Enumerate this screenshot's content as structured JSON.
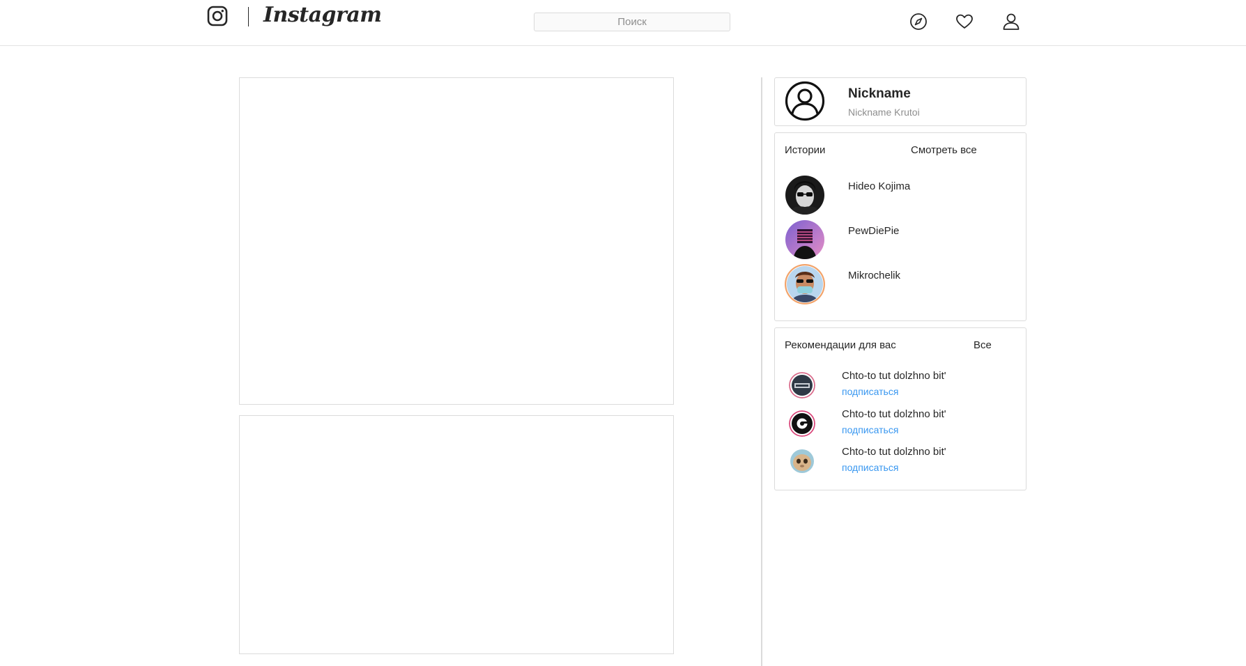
{
  "header": {
    "brand": "Instagram",
    "search_placeholder": "Поиск",
    "icons": [
      "instagram-logo-icon",
      "compass-icon",
      "heart-icon",
      "user-icon"
    ]
  },
  "profile": {
    "nickname": "Nickname",
    "full_name": "Nickname Krutoi"
  },
  "stories": {
    "title": "Истории",
    "see_all": "Смотреть все",
    "items": [
      {
        "name": "Hideo Kojima"
      },
      {
        "name": "PewDiePie"
      },
      {
        "name": "Mikrochelik"
      }
    ]
  },
  "suggestions": {
    "title": "Рекомендации для вас",
    "see_all": "Все",
    "items": [
      {
        "text": "Chto-to tut dolzhno bit'",
        "action": "подписаться"
      },
      {
        "text": "Chto-to tut dolzhno bit'",
        "action": "подписаться"
      },
      {
        "text": "Chto-to tut dolzhno bit'",
        "action": "подписаться"
      }
    ]
  },
  "colors": {
    "border": "#dbdbdb",
    "text": "#262626",
    "muted": "#8e8e8e",
    "link": "#3897f0"
  }
}
